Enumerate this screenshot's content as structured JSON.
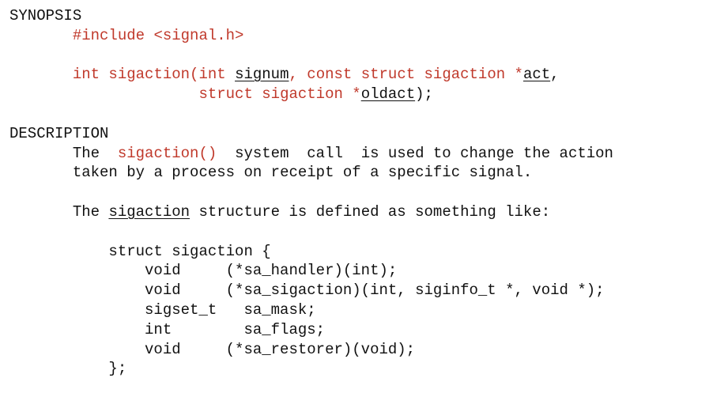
{
  "synopsis": {
    "heading": "SYNOPSIS",
    "include": "#include <signal.h>",
    "proto_int": "int sigaction(int ",
    "proto_signum": "signum",
    "proto_comma": ", ",
    "proto_const": "const struct sigaction *",
    "proto_act": "act",
    "proto_comma2": ",",
    "proto_struct": "struct sigaction *",
    "proto_oldact": "oldact",
    "proto_end": ");"
  },
  "description": {
    "heading": "DESCRIPTION",
    "p1_the": "The  ",
    "p1_func": "sigaction()",
    "p1_rest": "  system  call  is used to change the action",
    "p1_line2": "taken by a process on receipt of a specific signal.",
    "p2_the": "The ",
    "p2_struct": "sigaction",
    "p2_rest": " structure is defined as something like:",
    "struct_open": "struct sigaction {",
    "fields": [
      "void     (*sa_handler)(int);",
      "void     (*sa_sigaction)(int, siginfo_t *, void *);",
      "sigset_t   sa_mask;",
      "int        sa_flags;",
      "void     (*sa_restorer)(void);"
    ],
    "struct_close": "};"
  }
}
